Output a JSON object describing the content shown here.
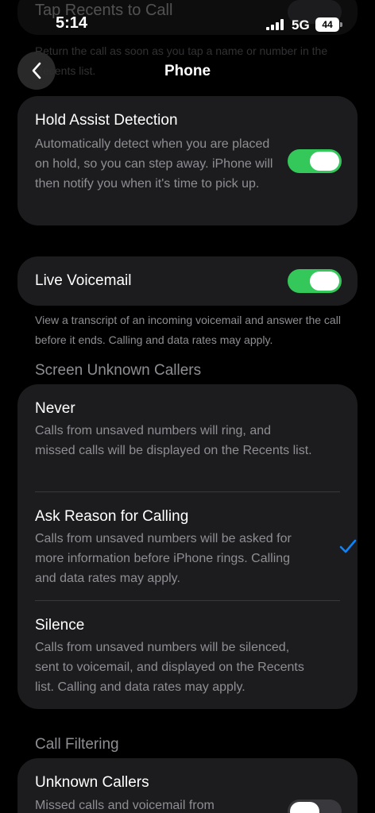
{
  "status_bar": {
    "time": "5:14",
    "network": "5G",
    "battery": "44"
  },
  "ghost": {
    "title": "Tap Recents to Call",
    "footer": "Return the call as soon as you tap a name or number in the Recents list."
  },
  "nav": {
    "title": "Phone"
  },
  "hold_assist": {
    "title": "Hold Assist Detection",
    "description": "Automatically detect when you are placed on hold, so you can step away. iPhone will then notify you when it's time to pick up.",
    "enabled": true
  },
  "live_voicemail": {
    "title": "Live Voicemail",
    "enabled": true,
    "footer": "View a transcript of an incoming voicemail and answer the call before it ends. Calling and data rates may apply."
  },
  "screen_unknown": {
    "header": "Screen Unknown Callers",
    "options": [
      {
        "title": "Never",
        "description": "Calls from unsaved numbers will ring, and missed calls will be displayed on the Recents list.",
        "selected": false
      },
      {
        "title": "Ask Reason for Calling",
        "description": "Calls from unsaved numbers will be asked for more information before iPhone rings. Calling and data rates may apply.",
        "selected": true
      },
      {
        "title": "Silence",
        "description": "Calls from unsaved numbers will be silenced, sent to voicemail, and displayed on the Recents list. Calling and data rates may apply.",
        "selected": false
      }
    ]
  },
  "call_filtering": {
    "header": "Call Filtering",
    "unknown_callers": {
      "title": "Unknown Callers",
      "description": "Missed calls and voicemail from",
      "enabled": false
    }
  },
  "colors": {
    "accent_green": "#34c759",
    "checkmark_blue": "#0a84ff",
    "card_background": "#1c1c1e",
    "secondary_text": "#8e8e93"
  },
  "icons": {
    "back": "chevron-left-icon",
    "check": "checkmark-icon",
    "signal": "cellular-signal-icon"
  }
}
